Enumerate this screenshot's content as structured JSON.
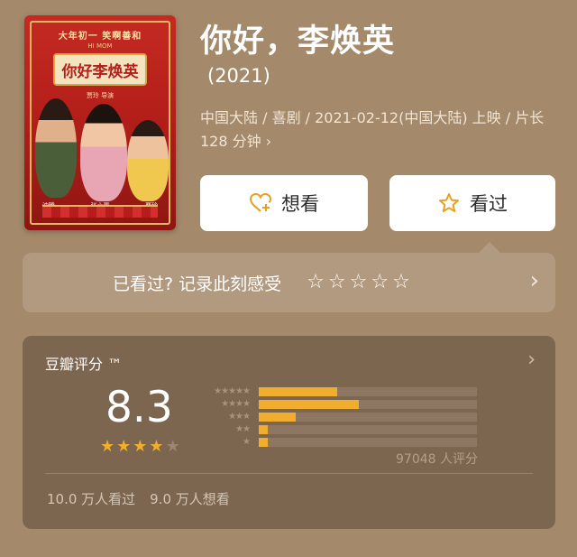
{
  "poster": {
    "top_text": "大年初一 笑啊善和",
    "sub_en": "HI MOM",
    "title": "你好李焕英",
    "credit": "贾玲 导演",
    "names": [
      "沈腾",
      "张小斐",
      "贾玲"
    ]
  },
  "movie": {
    "title": "你好，李焕英",
    "year": "(2021)",
    "meta": "中国大陆 / 喜剧 / 2021-02-12(中国大陆) 上映 / 片长 128 分钟 ›"
  },
  "buttons": {
    "want_label": "想看",
    "want_icon": "heart-plus-icon",
    "seen_label": "看过",
    "seen_icon": "star-outline-icon"
  },
  "record": {
    "prompt": "已看过? 记录此刻感受",
    "stars": 5,
    "chevron": "›"
  },
  "rating": {
    "label": "豆瓣评分 ™",
    "score": "8.3",
    "stars_filled": 4,
    "stars_total": 5,
    "distribution": [
      {
        "stars": "★★★★★",
        "fraction": 0.36
      },
      {
        "stars": "★★★★",
        "fraction": 0.46
      },
      {
        "stars": "★★★",
        "fraction": 0.17
      },
      {
        "stars": "★★",
        "fraction": 0.04
      },
      {
        "stars": "★",
        "fraction": 0.04
      }
    ],
    "count": "97048 人评分",
    "seen_count": "10.0 万人看过",
    "want_count": "9.0 万人想看",
    "colors": {
      "star_filled": "#f0ad2e",
      "star_empty": "#9b8672"
    }
  }
}
